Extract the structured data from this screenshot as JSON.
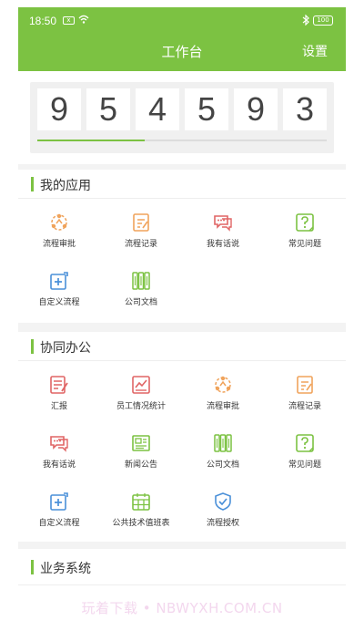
{
  "status_bar": {
    "time": "18:50",
    "sim_icon": "sim-card-icon",
    "wifi_icon": "wifi-icon",
    "bluetooth_icon": "bluetooth-icon",
    "battery": "100"
  },
  "header": {
    "title": "工作台",
    "settings_label": "设置"
  },
  "counter": {
    "digits": [
      "9",
      "5",
      "4",
      "5",
      "9",
      "3"
    ],
    "progress": 0.37
  },
  "my_apps": {
    "title": "我的应用",
    "items": [
      {
        "label": "流程审批",
        "icon": "workflow-approval-icon",
        "color": "#f0a35b"
      },
      {
        "label": "流程记录",
        "icon": "workflow-record-icon",
        "color": "#f0a35b"
      },
      {
        "label": "我有话说",
        "icon": "chat-bubble-icon",
        "color": "#e06565"
      },
      {
        "label": "常见问题",
        "icon": "faq-icon",
        "color": "#7cc242"
      },
      {
        "label": "自定义流程",
        "icon": "custom-flow-icon",
        "color": "#4a90d9"
      },
      {
        "label": "公司文档",
        "icon": "company-docs-icon",
        "color": "#7cc242"
      }
    ]
  },
  "collab": {
    "title": "协同办公",
    "items": [
      {
        "label": "汇报",
        "icon": "report-icon",
        "color": "#e06565"
      },
      {
        "label": "员工情况统计",
        "icon": "statistics-chart-icon",
        "color": "#e06565"
      },
      {
        "label": "流程审批",
        "icon": "workflow-approval-icon",
        "color": "#f0a35b"
      },
      {
        "label": "流程记录",
        "icon": "workflow-record-icon",
        "color": "#f0a35b"
      },
      {
        "label": "我有话说",
        "icon": "chat-bubble-icon",
        "color": "#e06565"
      },
      {
        "label": "新闻公告",
        "icon": "news-icon",
        "color": "#7cc242"
      },
      {
        "label": "公司文档",
        "icon": "company-docs-icon",
        "color": "#7cc242"
      },
      {
        "label": "常见问题",
        "icon": "faq-icon",
        "color": "#7cc242"
      },
      {
        "label": "自定义流程",
        "icon": "custom-flow-icon",
        "color": "#4a90d9"
      },
      {
        "label": "公共技术值班表",
        "icon": "calendar-icon",
        "color": "#7cc242"
      },
      {
        "label": "流程授权",
        "icon": "shield-check-icon",
        "color": "#4a90d9"
      }
    ]
  },
  "business": {
    "title": "业务系统"
  },
  "watermark": "玩着下载 • NBWYXH.COM.CN",
  "colors": {
    "brand": "#7cc242",
    "orange": "#f0a35b",
    "red": "#e06565",
    "blue": "#4a90d9"
  }
}
